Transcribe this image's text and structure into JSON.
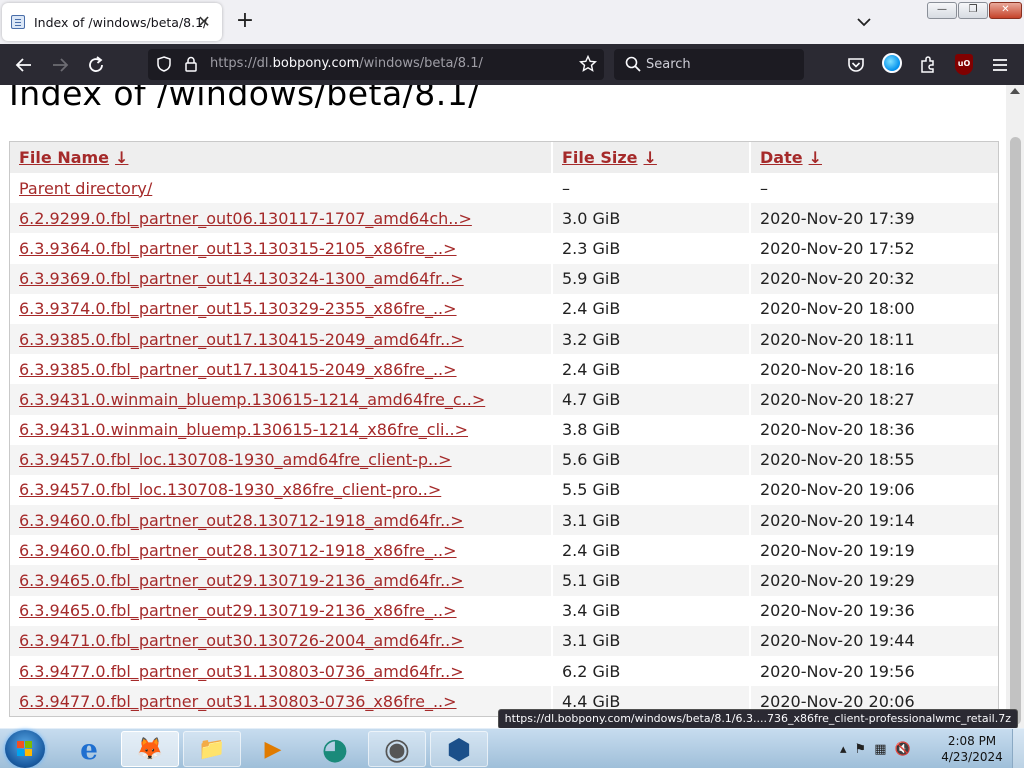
{
  "browser": {
    "tab_title": "Index of /windows/beta/8.1/",
    "tab_close": "✕",
    "new_tab": "+",
    "url_domain_prefix": "https://dl.",
    "url_domain": "bobpony.com",
    "url_path": "/windows/beta/8.1/",
    "search_placeholder": "Search",
    "ublock_badge": "uO",
    "window_buttons": {
      "minimize": "—",
      "restore": "❐",
      "close": "✕"
    }
  },
  "page": {
    "heading": "Index of /windows/beta/8.1/",
    "columns": [
      {
        "label": "File Name",
        "arrow": "↓"
      },
      {
        "label": "File Size",
        "arrow": "↓"
      },
      {
        "label": "Date",
        "arrow": "↓"
      }
    ],
    "rows": [
      {
        "name": "Parent directory/",
        "size": "–",
        "date": "–"
      },
      {
        "name": "6.2.9299.0.fbl_partner_out06.130117-1707_amd64ch..>",
        "size": "3.0 GiB",
        "date": "2020-Nov-20 17:39"
      },
      {
        "name": "6.3.9364.0.fbl_partner_out13.130315-2105_x86fre_..>",
        "size": "2.3 GiB",
        "date": "2020-Nov-20 17:52"
      },
      {
        "name": "6.3.9369.0.fbl_partner_out14.130324-1300_amd64fr..>",
        "size": "5.9 GiB",
        "date": "2020-Nov-20 20:32"
      },
      {
        "name": "6.3.9374.0.fbl_partner_out15.130329-2355_x86fre_..>",
        "size": "2.4 GiB",
        "date": "2020-Nov-20 18:00"
      },
      {
        "name": "6.3.9385.0.fbl_partner_out17.130415-2049_amd64fr..>",
        "size": "3.2 GiB",
        "date": "2020-Nov-20 18:11"
      },
      {
        "name": "6.3.9385.0.fbl_partner_out17.130415-2049_x86fre_..>",
        "size": "2.4 GiB",
        "date": "2020-Nov-20 18:16"
      },
      {
        "name": "6.3.9431.0.winmain_bluemp.130615-1214_amd64fre_c..>",
        "size": "4.7 GiB",
        "date": "2020-Nov-20 18:27"
      },
      {
        "name": "6.3.9431.0.winmain_bluemp.130615-1214_x86fre_cli..>",
        "size": "3.8 GiB",
        "date": "2020-Nov-20 18:36"
      },
      {
        "name": "6.3.9457.0.fbl_loc.130708-1930_amd64fre_client-p..>",
        "size": "5.6 GiB",
        "date": "2020-Nov-20 18:55"
      },
      {
        "name": "6.3.9457.0.fbl_loc.130708-1930_x86fre_client-pro..>",
        "size": "5.5 GiB",
        "date": "2020-Nov-20 19:06"
      },
      {
        "name": "6.3.9460.0.fbl_partner_out28.130712-1918_amd64fr..>",
        "size": "3.1 GiB",
        "date": "2020-Nov-20 19:14"
      },
      {
        "name": "6.3.9460.0.fbl_partner_out28.130712-1918_x86fre_..>",
        "size": "2.4 GiB",
        "date": "2020-Nov-20 19:19"
      },
      {
        "name": "6.3.9465.0.fbl_partner_out29.130719-2136_amd64fr..>",
        "size": "5.1 GiB",
        "date": "2020-Nov-20 19:29"
      },
      {
        "name": "6.3.9465.0.fbl_partner_out29.130719-2136_x86fre_..>",
        "size": "3.4 GiB",
        "date": "2020-Nov-20 19:36"
      },
      {
        "name": "6.3.9471.0.fbl_partner_out30.130726-2004_amd64fr..>",
        "size": "3.1 GiB",
        "date": "2020-Nov-20 19:44"
      },
      {
        "name": "6.3.9477.0.fbl_partner_out31.130803-0736_amd64fr..>",
        "size": "6.2 GiB",
        "date": "2020-Nov-20 19:56"
      },
      {
        "name": "6.3.9477.0.fbl_partner_out31.130803-0736_x86fre_..>",
        "size": "4.4 GiB",
        "date": "2020-Nov-20 20:06"
      }
    ],
    "status_link": "https://dl.bobpony.com/windows/beta/8.1/6.3....736_x86fre_client-professionalwmc_retail.7z"
  },
  "taskbar": {
    "items": [
      {
        "name": "internet-explorer",
        "glyph": "e"
      },
      {
        "name": "firefox",
        "glyph": "🦊"
      },
      {
        "name": "file-explorer",
        "glyph": "📁"
      },
      {
        "name": "media-player",
        "glyph": "▶"
      },
      {
        "name": "network-app",
        "glyph": "◕"
      },
      {
        "name": "disc-burner",
        "glyph": "◉"
      },
      {
        "name": "virtualbox",
        "glyph": "⬢"
      }
    ],
    "clock_time": "2:08 PM",
    "clock_date": "4/23/2024"
  },
  "colors": {
    "link": "#a52a2a",
    "toolbar_dark": "#2b2a33",
    "table_header_bg": "#eeeeee"
  }
}
